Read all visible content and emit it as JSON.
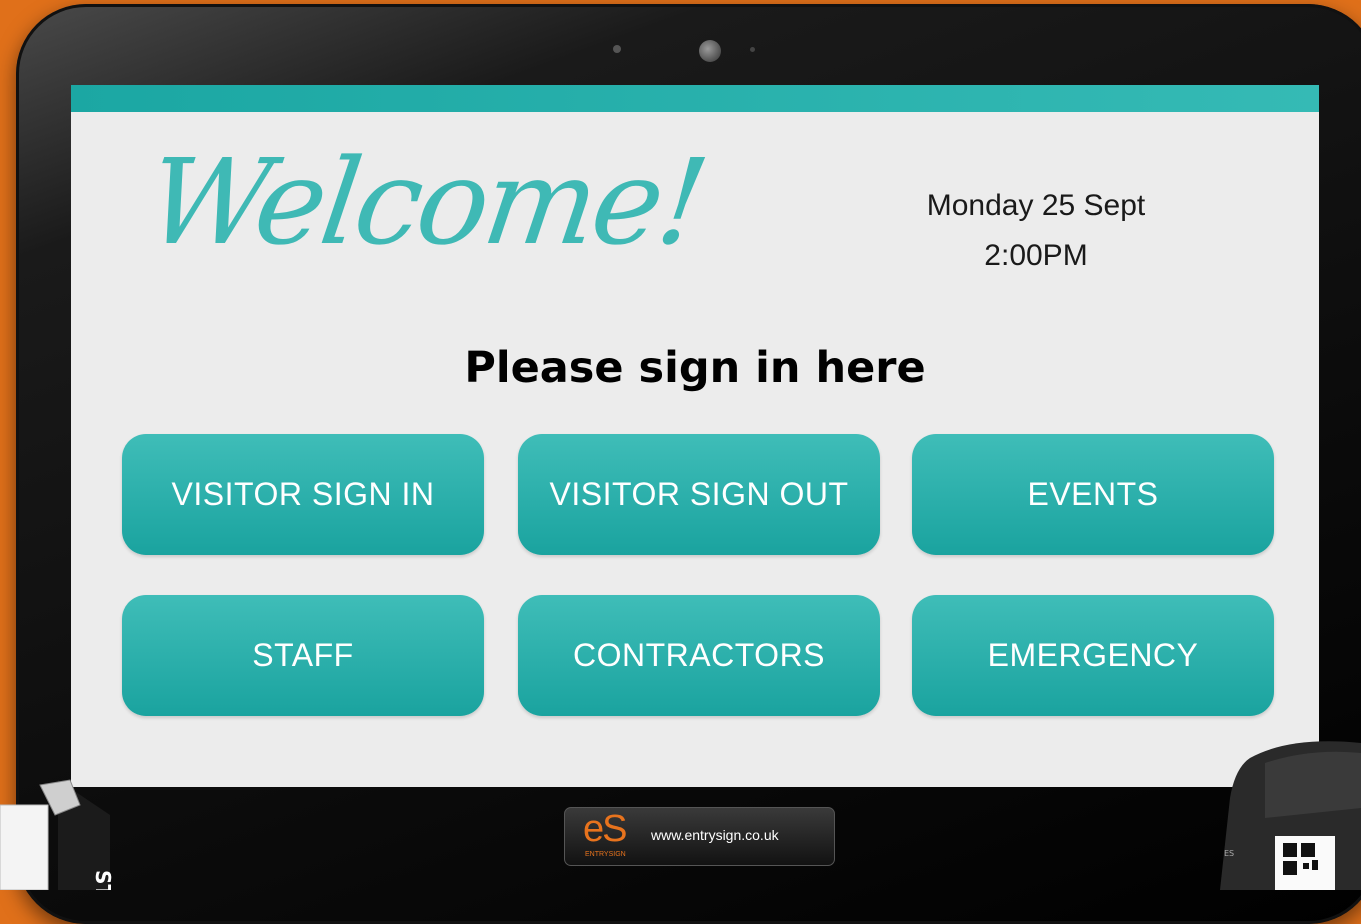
{
  "screen": {
    "welcome": "Welcome!",
    "date": "Monday 25 Sept",
    "time": "2:00PM",
    "heading": "Please sign in here",
    "buttons": [
      {
        "label": "VISITOR SIGN IN"
      },
      {
        "label": "VISITOR SIGN OUT"
      },
      {
        "label": "EVENTS"
      },
      {
        "label": "STAFF"
      },
      {
        "label": "CONTRACTORS"
      },
      {
        "label": "EMERGENCY"
      }
    ]
  },
  "brand": {
    "logo": "eS",
    "logo_sub": "ENTRYSIGN",
    "url": "www.entrysign.co.uk"
  },
  "lanyard_text": "ST",
  "printer_text": "ES",
  "colors": {
    "accent": "#3fb9b5",
    "button_top": "#3fbdb8",
    "button_bottom": "#1aa39f",
    "background": "#e0701a",
    "brand_orange": "#e8731d"
  }
}
